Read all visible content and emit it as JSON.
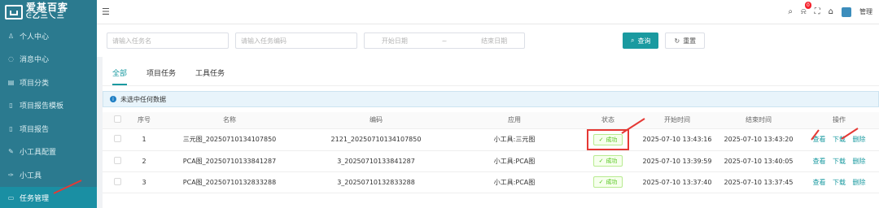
{
  "sidebar": {
    "logo_line1": "爱基百客",
    "logo_line2": "ᕮ乙三乀三",
    "items": [
      {
        "label": "个人中心",
        "icon": "user-icon",
        "glyph": "♙"
      },
      {
        "label": "消息中心",
        "icon": "message-icon",
        "glyph": "◌"
      },
      {
        "label": "项目分类",
        "icon": "category-icon",
        "glyph": "▤"
      },
      {
        "label": "项目报告模板",
        "icon": "document-icon",
        "glyph": "▯"
      },
      {
        "label": "项目报告",
        "icon": "report-icon",
        "glyph": "▯"
      },
      {
        "label": "小工具配置",
        "icon": "edit-icon",
        "glyph": "✎"
      },
      {
        "label": "小工具",
        "icon": "tool-icon",
        "glyph": "✑"
      },
      {
        "label": "任务管理",
        "icon": "task-icon",
        "glyph": "▭"
      }
    ]
  },
  "topbar": {
    "menu_glyph": "☰",
    "search_glyph": "🔍",
    "bell_glyph": "🔔",
    "bell_count": "0",
    "fullscreen_glyph": "⛶",
    "lock_glyph": "🔒",
    "admin": "管理"
  },
  "filters": {
    "name_placeholder": "请输入任务名",
    "code_placeholder": "请输入任务编码",
    "start_date": "开始日期",
    "sep": "~",
    "end_date": "结束日期",
    "query": "查询",
    "reset": "重置"
  },
  "tabs": [
    "全部",
    "项目任务",
    "工具任务"
  ],
  "notice": "未选中任何数据",
  "table": {
    "headers": [
      "序号",
      "名称",
      "编码",
      "应用",
      "状态",
      "开始时间",
      "结束时间",
      "操作"
    ],
    "rows": [
      {
        "no": "1",
        "name": "三元图_20250710134107850",
        "code": "2121_20250710134107850",
        "app": "小工具:三元图",
        "status": "成功",
        "start": "2025-07-10 13:43:16",
        "end": "2025-07-10 13:43:20"
      },
      {
        "no": "2",
        "name": "PCA图_20250710133841287",
        "code": "3_20250710133841287",
        "app": "小工具:PCA图",
        "status": "成功",
        "start": "2025-07-10 13:39:59",
        "end": "2025-07-10 13:40:05"
      },
      {
        "no": "3",
        "name": "PCA图_20250710132833288",
        "code": "3_20250710132833288",
        "app": "小工具:PCA图",
        "status": "成功",
        "start": "2025-07-10 13:37:40",
        "end": "2025-07-10 13:37:45"
      }
    ],
    "ops": [
      "查看",
      "下载",
      "删除"
    ]
  },
  "colors": {
    "sidebar": "#2b7a8f",
    "accent": "#1a9aa0",
    "success": "#52c41a",
    "annotation": "#e53935"
  }
}
